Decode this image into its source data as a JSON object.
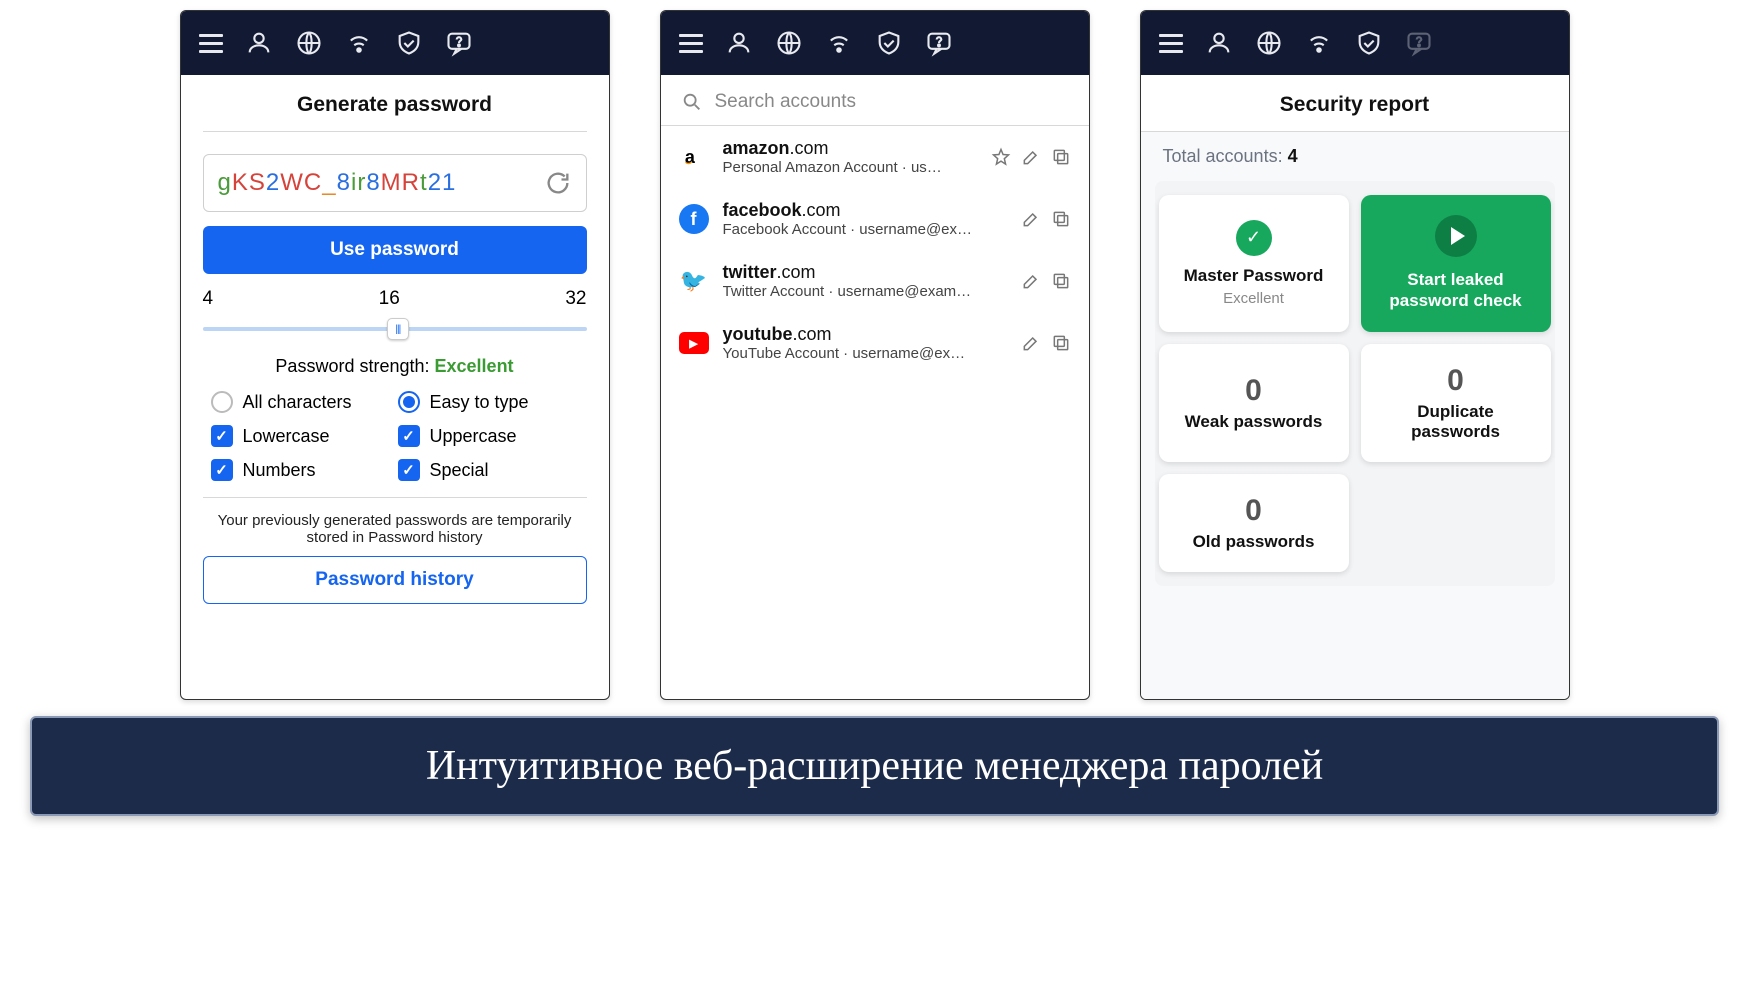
{
  "caption": "Интуитивное веб-расширение менеджера паролей",
  "panel1": {
    "title": "Generate password",
    "password": "gKS2WC_8ir8MRt21",
    "use_btn": "Use password",
    "slider": {
      "min": "4",
      "value": "16",
      "max": "32"
    },
    "strength_label": "Password strength:",
    "strength_value": "Excellent",
    "opt_all": "All characters",
    "opt_easy": "Easy to type",
    "opt_lower": "Lowercase",
    "opt_upper": "Uppercase",
    "opt_num": "Numbers",
    "opt_spec": "Special",
    "history_note": "Your previously generated passwords are temporarily stored in Password history",
    "history_btn": "Password history"
  },
  "panel2": {
    "search_placeholder": "Search accounts",
    "accounts": {
      "0": {
        "bold": "amazon",
        "rest": ".com",
        "sub": "Personal Amazon Account · us…"
      },
      "1": {
        "bold": "facebook",
        "rest": ".com",
        "sub": "Facebook Account · username@exa…"
      },
      "2": {
        "bold": "twitter",
        "rest": ".com",
        "sub": "Twitter Account · username@exampl…"
      },
      "3": {
        "bold": "youtube",
        "rest": ".com",
        "sub": "YouTube Account · username@exam…"
      }
    }
  },
  "panel3": {
    "title": "Security report",
    "total_label": "Total accounts:",
    "total_value": "4",
    "master_label": "Master Password",
    "master_status": "Excellent",
    "leak_btn": "Start leaked password check",
    "weak_count": "0",
    "weak_label": "Weak passwords",
    "dup_count": "0",
    "dup_label": "Duplicate passwords",
    "old_count": "0",
    "old_label": "Old passwords"
  }
}
